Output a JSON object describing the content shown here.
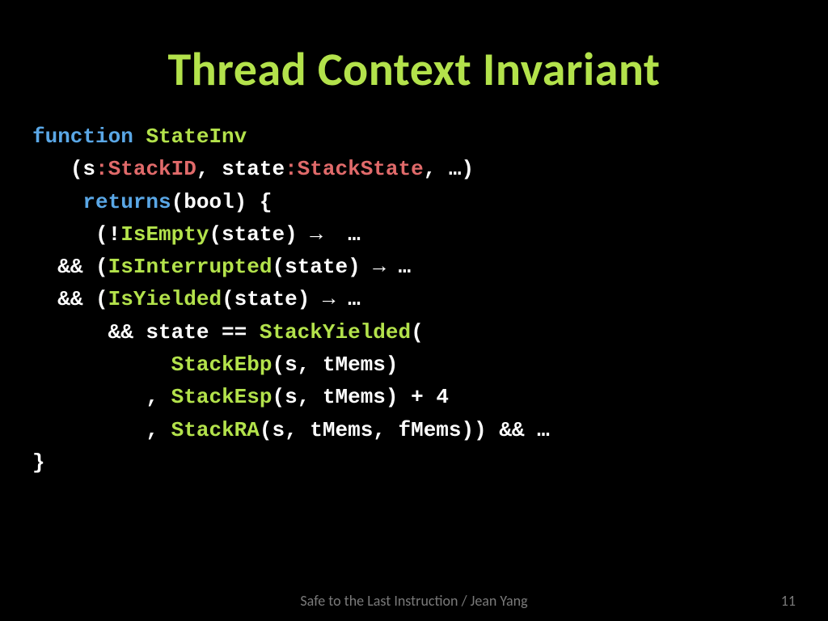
{
  "title": "Thread Context Invariant",
  "tokens": {
    "function": "function",
    "stateinv": "StateInv",
    "lparen1": "(s",
    "colon_stackid": ":StackID",
    "comma_state": ", state",
    "colon_stackstate": ":StackState",
    "params_tail": ", …)",
    "returns": "returns",
    "returns_tail": "(bool) {",
    "bang": "(!",
    "isempty": "IsEmpty",
    "isempty_tail": "(state) →  …",
    "and1": "&& (",
    "isinterrupted": "IsInterrupted",
    "isinterrupted_tail": "(state) → …",
    "and2": "&& (",
    "isyielded": "IsYielded",
    "isyielded_tail": "(state) → …",
    "state_eq": "&& state == ",
    "stackyielded": "StackYielded",
    "stackyielded_tail": "(",
    "stackebp": "StackEbp",
    "stackebp_tail": "(s, tMems)",
    "comma": ", ",
    "stackesp": "StackEsp",
    "stackesp_tail": "(s, tMems) + 4",
    "stackra": "StackRA",
    "stackra_tail": "(s, tMems, fMems)) && …",
    "closebrace": "}"
  },
  "footer": {
    "text": "Safe to the Last Instruction / Jean Yang",
    "page": "11"
  }
}
